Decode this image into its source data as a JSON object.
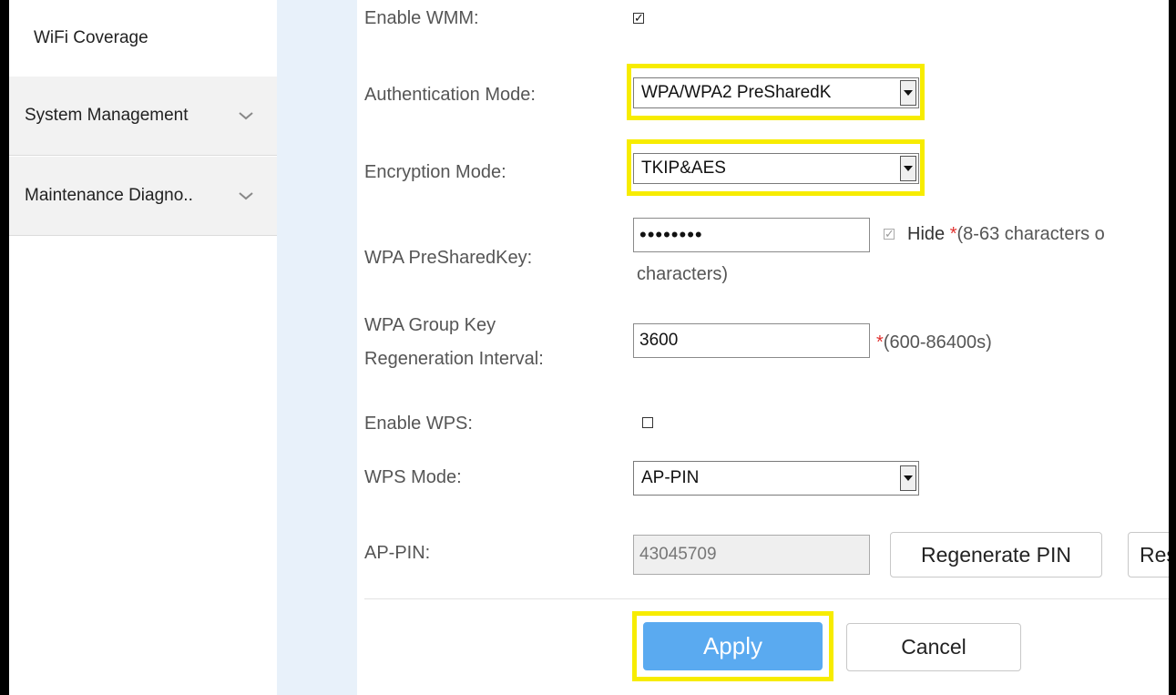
{
  "sidebar": {
    "items": [
      {
        "label": "WiFi Coverage"
      },
      {
        "label": "System Management"
      },
      {
        "label": "Maintenance Diagno.."
      }
    ]
  },
  "form": {
    "wmm_label": "Enable WMM:",
    "wmm_checked": true,
    "auth_label": "Authentication Mode:",
    "auth_value": "WPA/WPA2 PreSharedK",
    "enc_label": "Encryption Mode:",
    "enc_value": "TKIP&AES",
    "psk_label": "WPA PreSharedKey:",
    "psk_value": "••••••••",
    "psk_hide_label": "Hide",
    "psk_hide_checked": true,
    "psk_note_1": "(8-63 characters o",
    "psk_note_2": "characters)",
    "required_mark": "*",
    "gk_label_1": "WPA Group Key",
    "gk_label_2": "Regeneration Interval:",
    "gk_value": "3600",
    "gk_note": "(600-86400s)",
    "wps_label": "Enable WPS:",
    "wps_checked": false,
    "wps_mode_label": "WPS Mode:",
    "wps_mode_value": "AP-PIN",
    "appin_label": "AP-PIN:",
    "appin_value": "43045709",
    "regen_button": "Regenerate PIN",
    "reset_button": "Res"
  },
  "actions": {
    "apply": "Apply",
    "cancel": "Cancel"
  },
  "colors": {
    "highlight": "#f7ec00",
    "primary": "#5aaaf0",
    "required": "#e0302e"
  }
}
